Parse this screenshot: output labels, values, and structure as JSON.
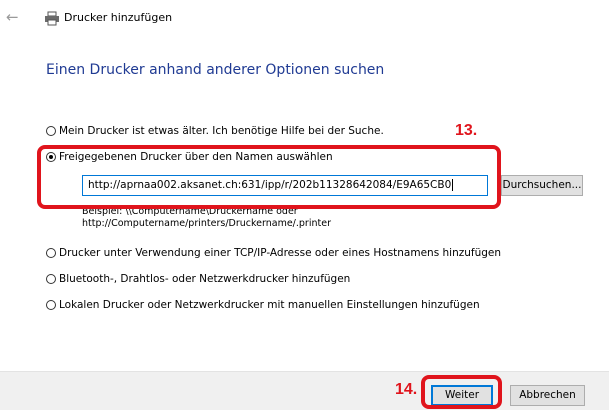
{
  "window": {
    "back_icon": "arrow-left-icon",
    "icon": "printer-icon",
    "title": "Drucker hinzufügen"
  },
  "heading": "Einen Drucker anhand anderer Optionen suchen",
  "options": [
    {
      "label": "Mein Drucker ist etwas älter. Ich benötige Hilfe bei der Suche.",
      "selected": false
    },
    {
      "label": "Freigegebenen Drucker über den Namen auswählen",
      "selected": true
    },
    {
      "label": "Drucker unter Verwendung einer TCP/IP-Adresse oder eines Hostnamens hinzufügen",
      "selected": false
    },
    {
      "label": "Bluetooth-, Drahtlos- oder Netzwerkdrucker hinzufügen",
      "selected": false
    },
    {
      "label": "Lokalen Drucker oder Netzwerkdrucker mit manuellen Einstellungen hinzufügen",
      "selected": false
    }
  ],
  "shared_printer": {
    "value": "http://aprnaa002.aksanet.ch:631/ipp/r/202b11328642084/E9A65CB0",
    "browse_label": "Durchsuchen...",
    "example_line1": "Beispiel: \\\\Computername\\Druckername oder",
    "example_line2": "http://Computername/printers/Druckername/.printer"
  },
  "annotations": {
    "step13": "13.",
    "step14": "14.",
    "highlight_color": "#e0141c"
  },
  "footer": {
    "next_label": "Weiter",
    "cancel_label": "Abbrechen"
  }
}
